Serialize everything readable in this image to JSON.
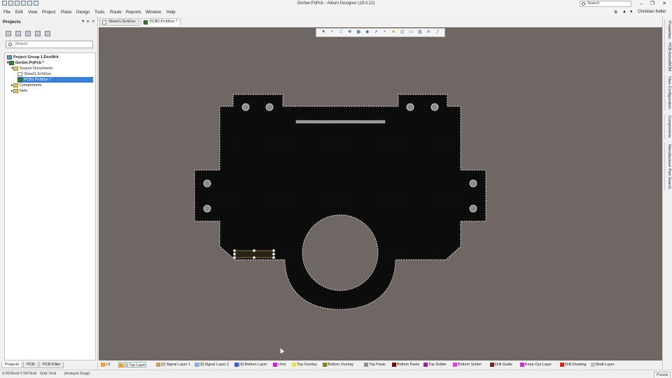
{
  "window": {
    "title": "Gerber.PrjPcb - Altium Designer (19.0.12)",
    "search_label": "Search",
    "user_name": "Christian Keller"
  },
  "menu": [
    "File",
    "Edit",
    "View",
    "Project",
    "Place",
    "Design",
    "Tools",
    "Route",
    "Reports",
    "Window",
    "Help"
  ],
  "projects_panel": {
    "title": "Projects",
    "search_placeholder": "Search",
    "tree": [
      {
        "label": "Project Group 1.DsnWrk",
        "icon": "project-group-icon",
        "indent": 0,
        "bold": true
      },
      {
        "label": "Gerber.PrjPcb *",
        "icon": "pcb-project-icon",
        "indent": 1,
        "bold": true
      },
      {
        "label": "Source Documents",
        "icon": "folder-icon",
        "indent": 2
      },
      {
        "label": "Sheet1.SchDoc",
        "icon": "schematic-doc-icon",
        "indent": 3
      },
      {
        "label": "PCB1.PcbDoc *",
        "icon": "pcb-doc-icon",
        "indent": 3,
        "selected": true
      },
      {
        "label": "Components",
        "icon": "folder-icon",
        "indent": 2
      },
      {
        "label": "Nets",
        "icon": "folder-icon",
        "indent": 2
      }
    ],
    "bottom_tabs": [
      "Projects",
      "PCB",
      "PCB Filter"
    ]
  },
  "document_tabs": [
    {
      "label": "Sheet1.SchDoc",
      "active": false
    },
    {
      "label": "PCB1.PcbDoc *",
      "active": true
    }
  ],
  "pcb_toolbar_icons": [
    "filter-icon",
    "add-icon",
    "select-rect-icon",
    "move-icon",
    "align-icon",
    "place-pad-icon",
    "route-icon",
    "interactive-route-icon",
    "highlight-icon",
    "keepout-icon",
    "polygon-icon",
    "dimension-icon",
    "text-icon",
    "line-icon"
  ],
  "right_panel_tabs": [
    "Properties",
    "PCB ActiveBOM",
    "View Configuration",
    "Components",
    "Manufacturer Part Search"
  ],
  "layers": [
    {
      "label": "LS",
      "color": "#f0a030"
    },
    {
      "label": "[1] Top Layer",
      "color": "#e8a23a",
      "active": true
    },
    {
      "label": "[2] Signal Layer 1",
      "color": "#c8a060"
    },
    {
      "label": "[3] Signal Layer 2",
      "color": "#7ab0e0"
    },
    {
      "label": "[4] Bottom Layer",
      "color": "#3a5cd8"
    },
    {
      "label": "chns",
      "color": "#d020d0"
    },
    {
      "label": "Top Overlay",
      "color": "#f0e040"
    },
    {
      "label": "Bottom Overlay",
      "color": "#808020"
    },
    {
      "label": "Top Paste",
      "color": "#909090"
    },
    {
      "label": "Bottom Paste",
      "color": "#800000"
    },
    {
      "label": "Top Solder",
      "color": "#a020a0"
    },
    {
      "label": "Bottom Solder",
      "color": "#e040e0"
    },
    {
      "label": "Drill Guide",
      "color": "#802020"
    },
    {
      "label": "Keep-Out Layer",
      "color": "#e020e0"
    },
    {
      "label": "Drill Drawing",
      "color": "#e02020"
    },
    {
      "label": "Multi-Layer",
      "color": "#c0c0c0"
    }
  ],
  "status": {
    "coords": "X:2535mil Y:1870mil",
    "grid": "Grid: 5mil",
    "snap": "(Hotspot Snap)",
    "panels_button": "Panels"
  },
  "colors": {
    "canvas_bg": "#6e6764",
    "board_fill": "#0b0b0b",
    "board_outline": "#d8d8d8",
    "selection": "#3d7ed5"
  }
}
